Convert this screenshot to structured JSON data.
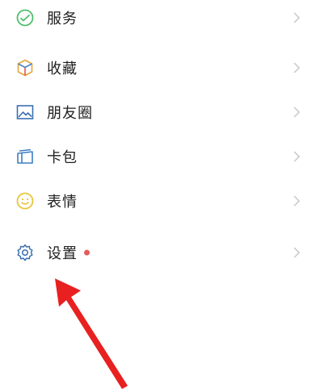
{
  "menu": {
    "items": [
      {
        "label": "服务",
        "icon": "service-icon",
        "color": "#4fbf6a"
      },
      {
        "label": "收藏",
        "icon": "favorites-cube-icon",
        "color": "#e4a73a"
      },
      {
        "label": "朋友圈",
        "icon": "moments-photo-icon",
        "color": "#3b6fb0"
      },
      {
        "label": "卡包",
        "icon": "card-wallet-icon",
        "color": "#3b7fc4"
      },
      {
        "label": "表情",
        "icon": "emoji-smile-icon",
        "color": "#e8c53a"
      },
      {
        "label": "设置",
        "icon": "settings-gear-icon",
        "color": "#3b6fb0",
        "badge": "red-dot"
      }
    ]
  },
  "colors": {
    "chevron": "#c8c8c8",
    "badge": "#e45a5a",
    "annotation_arrow": "#e82020"
  }
}
